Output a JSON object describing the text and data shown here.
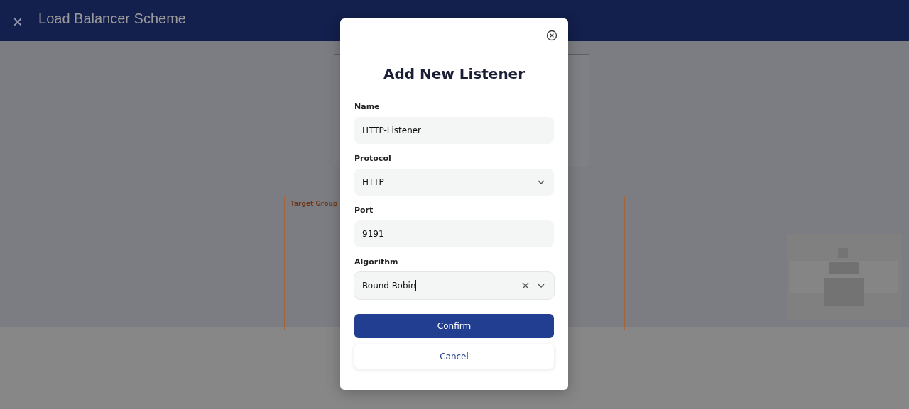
{
  "header": {
    "close_icon": "×",
    "title": "Load Balancer Scheme"
  },
  "diagram": {
    "nodes": [
      {
        "kind": "box"
      },
      {
        "kind": "group",
        "label": "Target Group"
      }
    ]
  },
  "dialog": {
    "title": "Add New Listener",
    "fields": [
      {
        "label": "Name",
        "kind": "text",
        "value": "HTTP-Listener",
        "clearable": false,
        "focused": false
      },
      {
        "label": "Protocol",
        "kind": "select",
        "value": "HTTP",
        "clearable": false,
        "focused": false
      },
      {
        "label": "Port",
        "kind": "text",
        "value": "9191",
        "clearable": false,
        "focused": false
      },
      {
        "label": "Algorithm",
        "kind": "select",
        "value": "Round Robin",
        "clearable": true,
        "focused": true
      }
    ],
    "buttons": [
      {
        "label": "Confirm",
        "kind": "primary"
      },
      {
        "label": "Cancel",
        "kind": "secondary"
      }
    ]
  }
}
